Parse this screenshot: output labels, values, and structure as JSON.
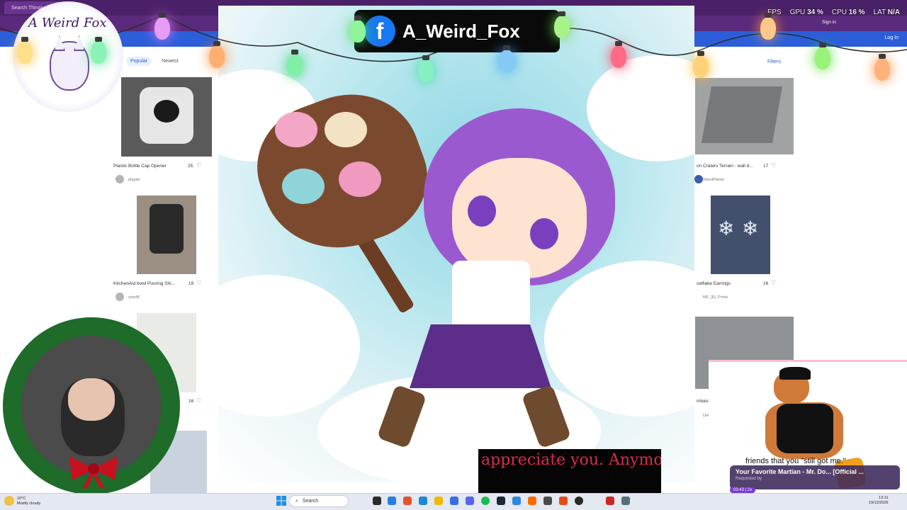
{
  "browser": {
    "tab_label": "Search Thingiverse",
    "login": "Log In",
    "sign_in": "Sign in"
  },
  "perf": {
    "fps_label": "FPS",
    "gpu_label": "GPU",
    "gpu_value": "34 %",
    "cpu_label": "CPU",
    "cpu_value": "16 %",
    "lat_label": "LAT",
    "lat_value": "N/A"
  },
  "overlay": {
    "logo_text": "A Weird Fox",
    "fb_logo": "f",
    "fb_name": "A_Weird_Fox",
    "subtitle": "appreciate you. Anymore",
    "alert_quote": "friends that you \"still got me.\""
  },
  "listing": {
    "filters": "Filters",
    "sort_tabs": [
      {
        "label": "Popular"
      },
      {
        "label": "Newest"
      }
    ],
    "cards_left": [
      {
        "title": "Plastic Bottle Cap Opener",
        "count": "25",
        "user": "pbgale"
      },
      {
        "title": "KitchenAid bowl Pouring Shi...",
        "count": "19",
        "user": "zyto45"
      },
      {
        "title": "",
        "count": "16",
        "user": ""
      }
    ],
    "cards_right": [
      {
        "title": "on Craters Terrain - wall d...",
        "count": "17",
        "user": "SteedPlaner"
      },
      {
        "title": "owflake Earrings",
        "count": "16",
        "user": "MF_3D_Prints"
      },
      {
        "title": "mbardie",
        "count": "",
        "user": "Del"
      }
    ]
  },
  "song": {
    "title": "Your Favorite Martian - Mr. Do... [Official ...",
    "requested": "Requested by",
    "time": "03:43",
    "speed": "2x"
  },
  "taskbar": {
    "weather_temp": "10°C",
    "weather_desc": "Mostly cloudy",
    "search": "Search",
    "time": "13:11",
    "date": "19/12/2025"
  },
  "colors": {
    "accent": "#2b5ed8",
    "browser_chrome": "#3a1a5a",
    "subtitle_text": "#e0294f",
    "fb_blue": "#1877f2"
  }
}
